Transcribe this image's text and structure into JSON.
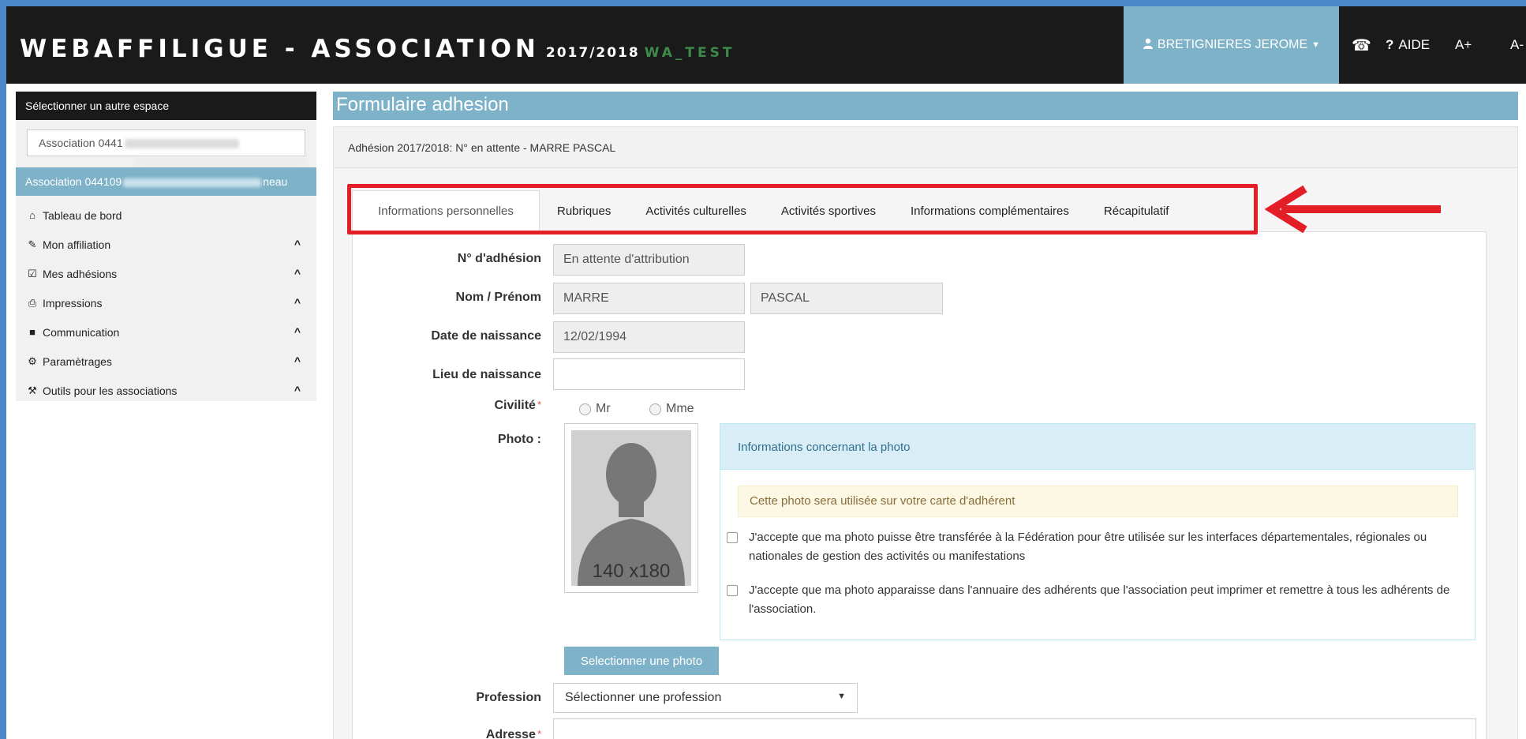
{
  "header": {
    "app_name": "WEBAFFILIGUE - ASSOCIATION",
    "season": "2017/2018",
    "environment": "WA_TEST",
    "user_name": "BRETIGNIERES JEROME",
    "help_label": "AIDE",
    "font_increase": "A+",
    "font_decrease": "A-"
  },
  "sidebar": {
    "heading": "Sélectionner un autre espace",
    "space_select_value": "Association 0441",
    "association_label_start": "Association 044109",
    "association_label_end": "neau",
    "items": [
      {
        "label": "Tableau de bord",
        "icon": "home-icon",
        "glyph": "⌂"
      },
      {
        "label": "Mon affiliation",
        "icon": "pencil-icon",
        "glyph": "✎"
      },
      {
        "label": "Mes adhésions",
        "icon": "edit-icon",
        "glyph": "☑"
      },
      {
        "label": "Impressions",
        "icon": "print-icon",
        "glyph": "⎙"
      },
      {
        "label": "Communication",
        "icon": "comment-icon",
        "glyph": "■"
      },
      {
        "label": "Paramètrages",
        "icon": "gear-icon",
        "glyph": "⚙"
      },
      {
        "label": "Outils pour les associations",
        "icon": "wrench-icon",
        "glyph": "⚒"
      }
    ]
  },
  "main": {
    "page_title": "Formulaire adhesion",
    "panel_heading": "Adhésion 2017/2018: N° en attente - MARRE PASCAL",
    "tabs": [
      {
        "label": "Informations personnelles",
        "active": true
      },
      {
        "label": "Rubriques"
      },
      {
        "label": "Activités culturelles"
      },
      {
        "label": "Activités sportives"
      },
      {
        "label": "Informations complémentaires"
      },
      {
        "label": "Récapitulatif"
      }
    ]
  },
  "form": {
    "adhesion_number_label": "N° d'adhésion",
    "adhesion_number_value": "En attente d'attribution",
    "name_label": "Nom / Prénom",
    "last_name": "MARRE",
    "first_name": "PASCAL",
    "birth_date_label": "Date de naissance",
    "birth_date": "12/02/1994",
    "birth_place_label": "Lieu de naissance",
    "birth_place": "",
    "civility_label": "Civilité",
    "civility_options": [
      "Mr",
      "Mme"
    ],
    "photo_label": "Photo :",
    "photo_placeholder": "140 x180",
    "select_photo_button": "Selectionner une photo",
    "profession_label": "Profession",
    "profession_value": "Sélectionner une profession",
    "address_label": "Adresse",
    "required_mark": "*"
  },
  "photo_info": {
    "heading": "Informations concernant la photo",
    "notice": "Cette photo sera utilisée sur votre carte d'adhérent",
    "consent_federation": "J'accepte que ma photo puisse être transférée à la Fédération pour être utilisée sur les interfaces départementales, régionales ou nationales de gestion des activités ou manifestations",
    "consent_directory": "J'accepte que ma photo apparaisse dans l'annuaire des adhérents que l'association peut imprimer et remettre à tous les adhérents de l'association."
  },
  "colors": {
    "accent": "#7eb2c8",
    "header_bg": "#1a1a1a",
    "highlight": "#e41e26",
    "frame": "#4a86c8"
  }
}
